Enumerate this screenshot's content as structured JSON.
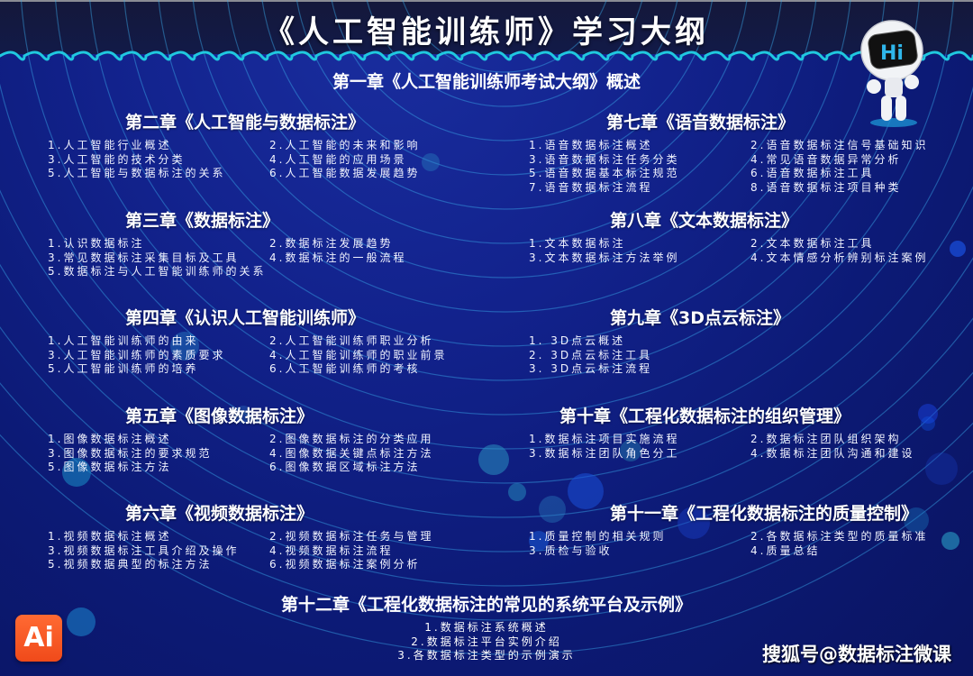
{
  "title": "《人工智能训练师》学习大纲",
  "chapter1": "第一章《人工智能训练师考试大纲》概述",
  "chapters_left": [
    {
      "heading": "第二章《人工智能与数据标注》",
      "items": [
        "1.人工智能行业概述",
        "2.人工智能的未来和影响",
        "3.人工智能的技术分类",
        "4.人工智能的应用场景",
        "5.人工智能与数据标注的关系",
        "6.人工智能数据发展趋势"
      ]
    },
    {
      "heading": "第三章《数据标注》",
      "items": [
        "1.认识数据标注",
        "2.数据标注发展趋势",
        "3.常见数据标注采集目标及工具",
        "4.数据标注的一般流程",
        "5.数据标注与人工智能训练师的关系"
      ]
    },
    {
      "heading": "第四章《认识人工智能训练师》",
      "items": [
        "1.人工智能训练师的由来",
        "2.人工智能训练师职业分析",
        "3.人工智能训练师的素质要求",
        "4.人工智能训练师的职业前景",
        "5.人工智能训练师的培养",
        "6.人工智能训练师的考核"
      ]
    },
    {
      "heading": "第五章《图像数据标注》",
      "items": [
        "1.图像数据标注概述",
        "2.图像数据标注的分类应用",
        "3.图像数据标注的要求规范",
        "4.图像数据关键点标注方法",
        "5.图像数据标注方法",
        "6.图像数据区域标注方法"
      ]
    },
    {
      "heading": "第六章《视频数据标注》",
      "items": [
        "1.视频数据标注概述",
        "2.视频数据标注任务与管理",
        "3.视频数据标注工具介绍及操作",
        "4.视频数据标注流程",
        "5.视频数据典型的标注方法",
        "6.视频数据标注案例分析"
      ]
    }
  ],
  "chapters_right": [
    {
      "heading": "第七章《语音数据标注》",
      "items": [
        "1.语音数据标注概述",
        "2.语音数据标注信号基础知识",
        "3.语音数据标注任务分类",
        "4.常见语音数据异常分析",
        "5.语音数据基本标注规范",
        "6.语音数据标注工具",
        "7.语音数据标注流程",
        "8.语音数据标注项目种类"
      ]
    },
    {
      "heading": "第八章《文本数据标注》",
      "items": [
        "1.文本数据标注",
        "2.文本数据标注工具",
        "3.文本数据标注方法举例",
        "4.文本情感分析辨别标注案例"
      ]
    },
    {
      "heading": "第九章《3D点云标注》",
      "items": [
        "1. 3D点云概述",
        "2. 3D点云标注工具",
        "3. 3D点云标注流程"
      ]
    },
    {
      "heading": "第十章《工程化数据标注的组织管理》",
      "items": [
        "1.数据标注项目实施流程",
        "2.数据标注团队组织架构",
        "3.数据标注团队角色分工",
        "4.数据标注团队沟通和建设"
      ]
    },
    {
      "heading": "第十一章《工程化数据标注的质量控制》",
      "items": [
        "1.质量控制的相关规则",
        "2.各数据标注类型的质量标准",
        "3.质检与验收",
        "4.质量总结"
      ]
    }
  ],
  "chapter12": {
    "heading": "第十二章《工程化数据标注的常见的系统平台及示例》",
    "items": [
      "1.数据标注系统概述",
      "2.数据标注平台实例介绍",
      "3.各数据标注类型的示例演示"
    ]
  },
  "robot_screen_text": "Hi",
  "ai_logo_text": "Ai",
  "watermark": "搜狐号@数据标注微课",
  "colors": {
    "background": "#0d1a78",
    "header_band": "#14183a",
    "wave_accent": "#20c8e0",
    "ai_logo": "#f04a1a"
  }
}
